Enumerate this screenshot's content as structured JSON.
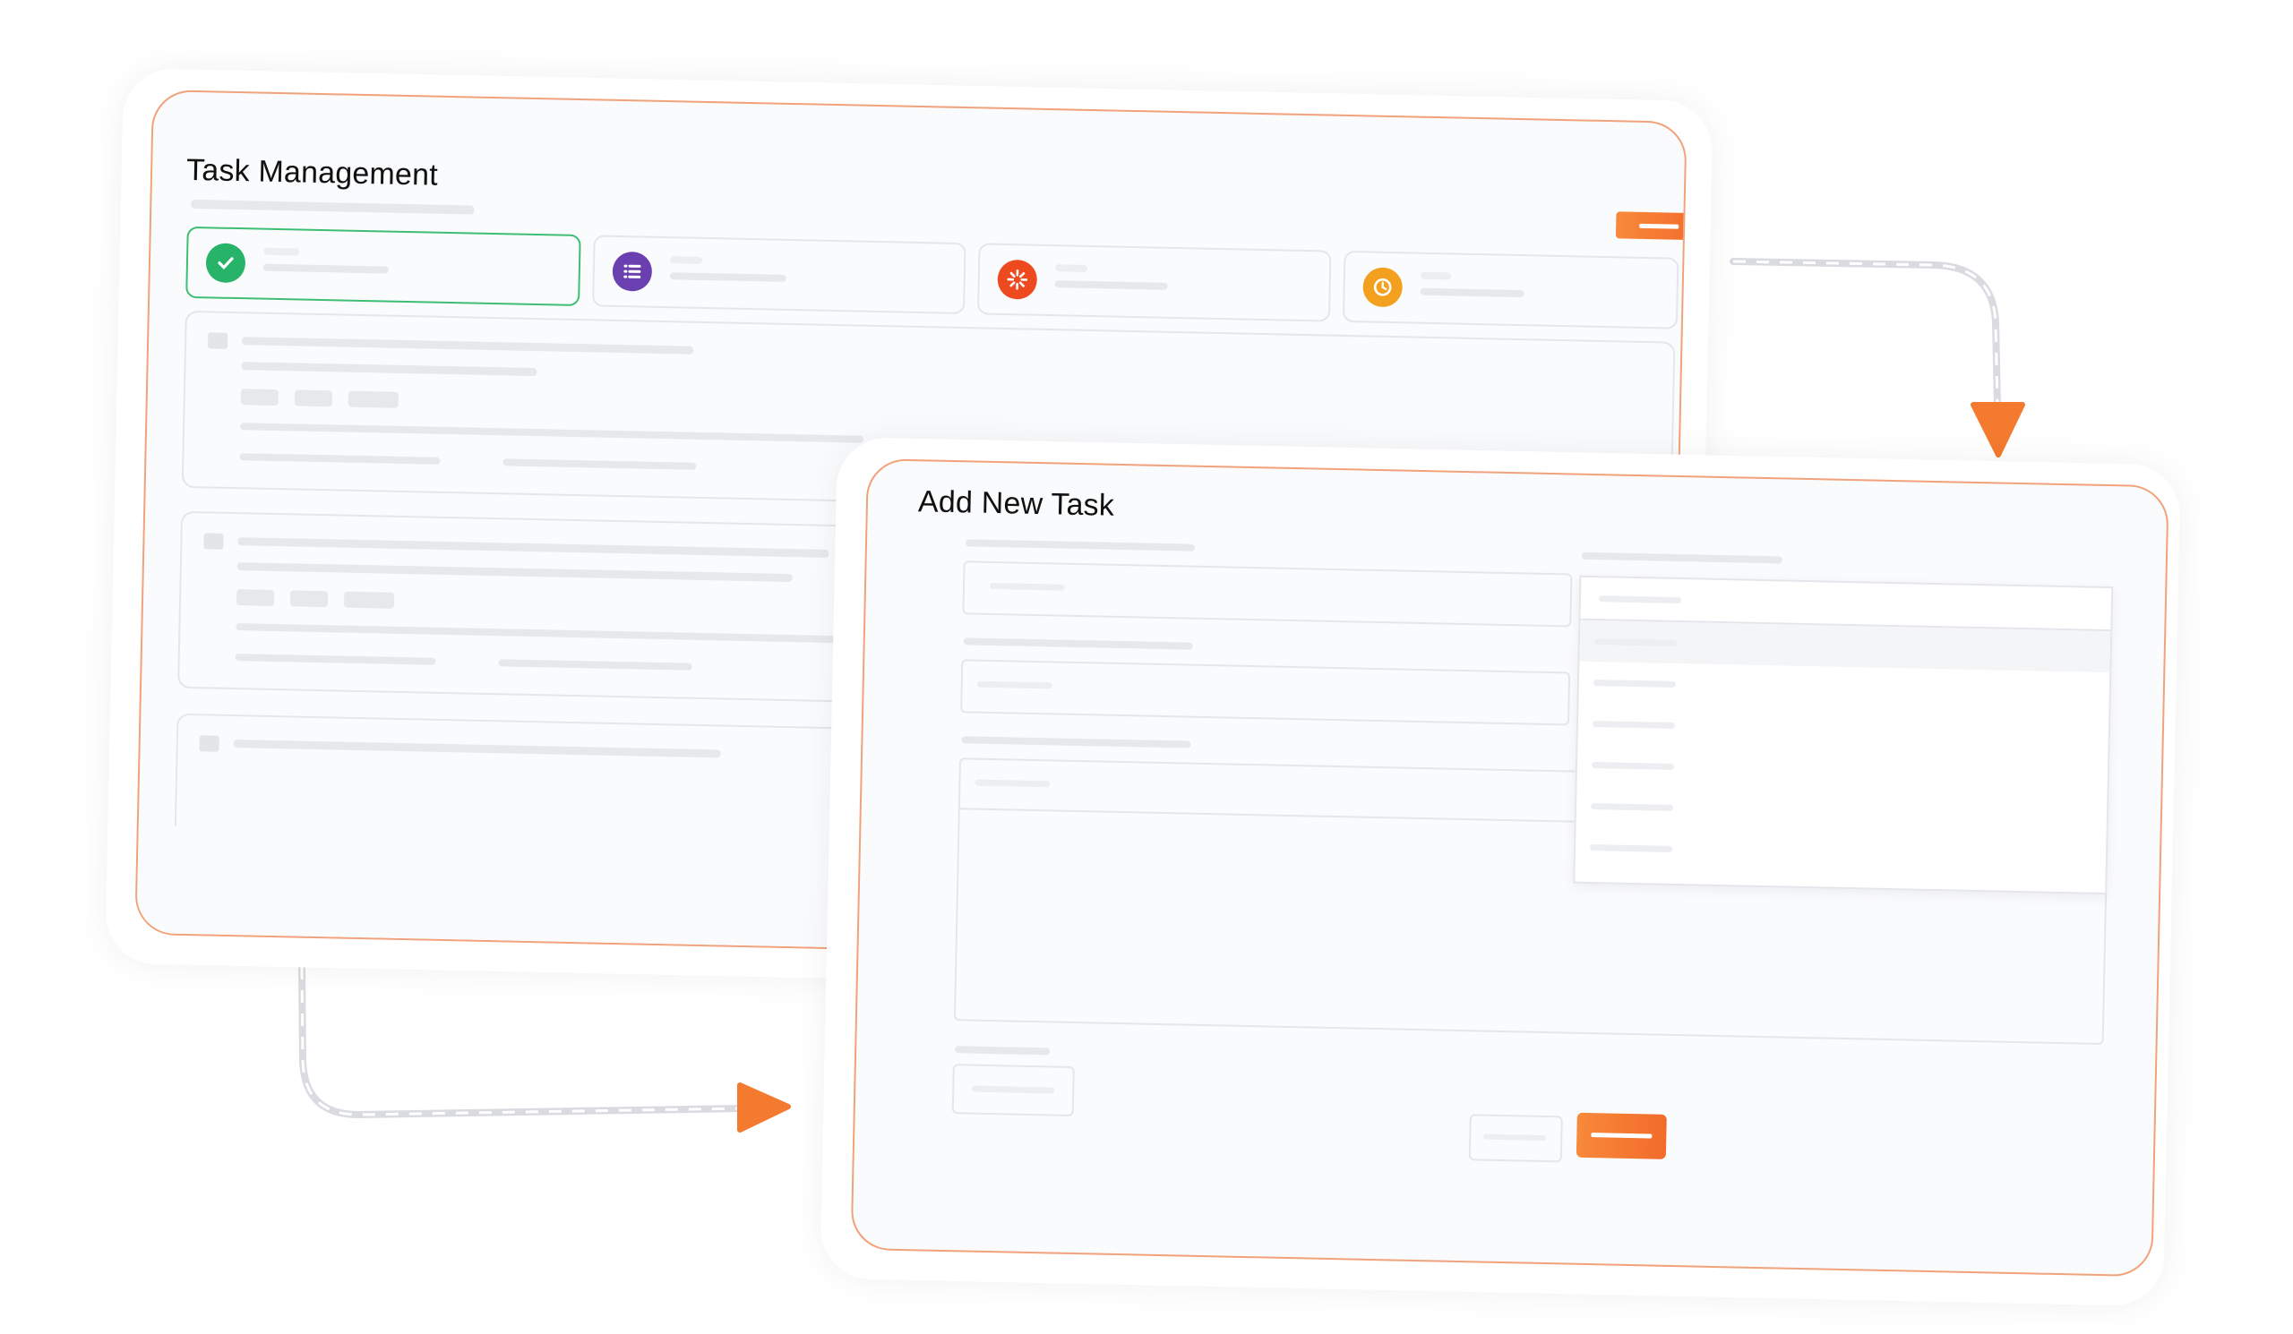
{
  "task_management": {
    "title": "Task Management"
  },
  "add_new_task": {
    "title": "Add New Task"
  },
  "colors": {
    "accent_orange": "#f26b2a",
    "active_green": "#3ebd74",
    "category_icons": [
      "#27b36a",
      "#6a3fb0",
      "#ee4a1f",
      "#f2a01e"
    ]
  },
  "icons": {
    "category_1": "check-progress-icon",
    "category_2": "list-icon",
    "category_3": "loader-icon",
    "category_4": "clock-icon",
    "flow_arrows": [
      "arrow-down-icon",
      "arrow-right-icon"
    ]
  }
}
